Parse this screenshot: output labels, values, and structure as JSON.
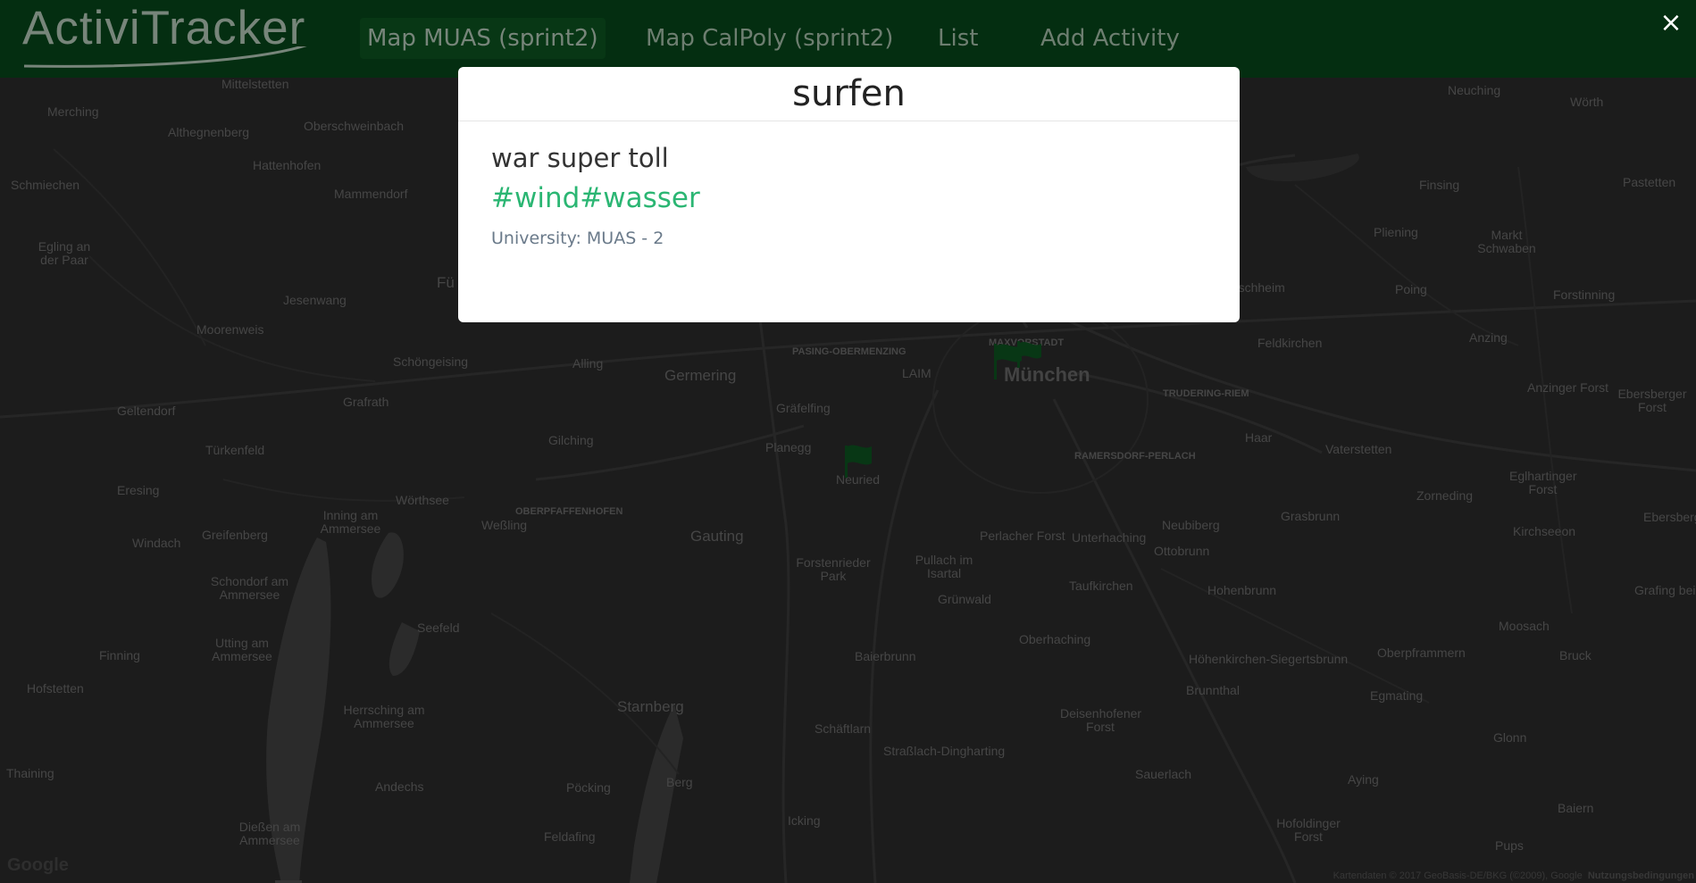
{
  "app": {
    "brand": "ActiviTracker",
    "nav": [
      {
        "label": "Map MUAS (sprint2)",
        "active": true
      },
      {
        "label": "Map CalPoly (sprint2)",
        "active": false
      },
      {
        "label": "List",
        "active": false
      },
      {
        "label": "Add Activity",
        "active": false
      }
    ]
  },
  "modal": {
    "title": "surfen",
    "description": "war super toll",
    "tags": "#wind#wasser",
    "university": "University: MUAS - 2",
    "close_icon": "×"
  },
  "map": {
    "places": [
      "Mittelstetten",
      "Merching",
      "Althegnenberg",
      "Oberschweinbach",
      "Hattenhofen",
      "Schmiechen",
      "Mammendorf",
      "Egling an der Paar",
      "Jesenwang",
      "Moorenweis",
      "Fürstenfeldbruck",
      "Schöngeising",
      "Alling",
      "Germering",
      "Geltendorf",
      "Grafrath",
      "Türkenfeld",
      "Gilching",
      "Eresing",
      "Wörthsee",
      "Windach",
      "Greifenberg",
      "Inning am Ammersee",
      "Weßling",
      "Schondorf am Ammersee",
      "Seefeld",
      "Utting am Ammersee",
      "Finning",
      "Hofstetten",
      "Herrsching am Ammersee",
      "Thaining",
      "Andechs",
      "Dießen am Ammersee",
      "Pöcking",
      "Berg",
      "Starnberg",
      "Feldafing",
      "Icking",
      "Gauting",
      "Forstenrieder Park",
      "Pullach im Isartal",
      "Grünwald",
      "Baierbrunn",
      "Schäftlarn",
      "Straßlach-Dingharting",
      "Planegg",
      "Neuried",
      "Gräfelfing",
      "LAIM",
      "PASING-OBERMENZING",
      "MAXVORSTADT",
      "München",
      "TRUDERING-RIEM",
      "RAMERSDORF-PERLACH",
      "Perlacher Forst",
      "Unterhaching",
      "Taufkirchen",
      "Oberhaching",
      "Deisenhofener Forst",
      "Sauerlach",
      "Hofoldinger Forst",
      "Brunnthal",
      "Höhenkirchen-Siegertsbrunn",
      "Hohenbrunn",
      "Ottobrunn",
      "Neubiberg",
      "Grasbrunn",
      "Haar",
      "Vaterstetten",
      "Zorneding",
      "Feldkirchen",
      "Aschheim",
      "Poing",
      "Pliening",
      "Finsing",
      "Markt Schwaben",
      "Neuching",
      "Wörth",
      "Pastetten",
      "Anzing",
      "Forstinning",
      "Anzinger Forst",
      "Ebersberger Forst",
      "Eglhartinger Forst",
      "Kirchseeon",
      "Ebersberg",
      "Grafing bei München",
      "Moosach",
      "Bruck",
      "Oberpframmern",
      "Egmating",
      "Glonn",
      "Aying",
      "Baiern",
      "Pups",
      "OBERPFAFFENHOFEN"
    ],
    "footer": "Kartendaten © 2017 GeoBasis-DE/BKG (©2009), Google",
    "footer_link": "Nutzungsbedingungen",
    "logo": "Google"
  }
}
